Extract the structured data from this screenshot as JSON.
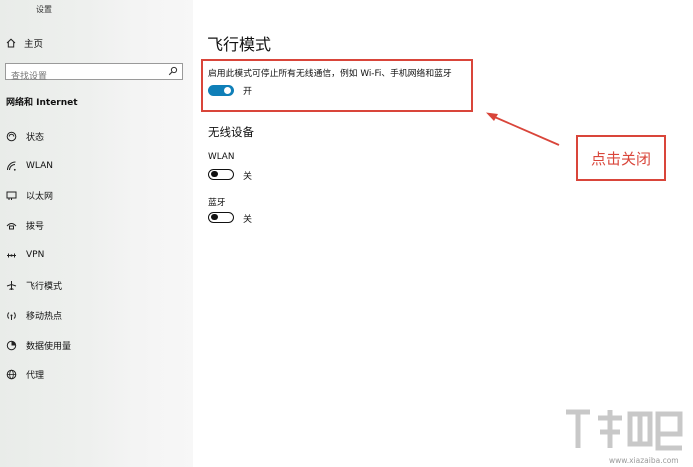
{
  "app": {
    "title": "设置"
  },
  "sidebar": {
    "home_label": "主页",
    "search_placeholder": "查找设置",
    "section_title": "网络和 Internet",
    "items": [
      {
        "label": "状态",
        "icon": "status-icon"
      },
      {
        "label": "WLAN",
        "icon": "wifi-icon"
      },
      {
        "label": "以太网",
        "icon": "ethernet-icon"
      },
      {
        "label": "拨号",
        "icon": "dialup-icon"
      },
      {
        "label": "VPN",
        "icon": "vpn-icon"
      },
      {
        "label": "飞行模式",
        "icon": "airplane-icon"
      },
      {
        "label": "移动热点",
        "icon": "hotspot-icon"
      },
      {
        "label": "数据使用量",
        "icon": "data-usage-icon"
      },
      {
        "label": "代理",
        "icon": "globe-icon"
      }
    ]
  },
  "main": {
    "title": "飞行模式",
    "description": "启用此模式可停止所有无线通信，例如 Wi-Fi、手机网络和蓝牙",
    "airplane_toggle": {
      "state": "开",
      "on": true
    },
    "wireless_heading": "无线设备",
    "devices": [
      {
        "label": "WLAN",
        "state": "关",
        "on": false
      },
      {
        "label": "蓝牙",
        "state": "关",
        "on": false
      }
    ]
  },
  "annotation": {
    "text": "点击关闭",
    "color": "#d9453a"
  },
  "watermark": {
    "text": "www.xiazaiba.com"
  },
  "colors": {
    "accent": "#0f7fb8",
    "annotation": "#d9453a"
  }
}
